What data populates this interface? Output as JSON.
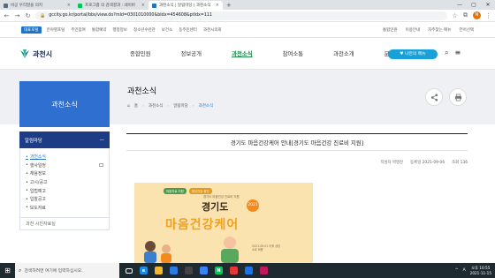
{
  "browser": {
    "tabs": [
      {
        "title": "비공 우리말을 의지",
        "fav": "#5b6b7c",
        "active": false
      },
      {
        "title": "프로그램 의 검색결과 : 네이버",
        "fav": "#03c75a",
        "active": false
      },
      {
        "title": "과천소식 | 알림마당 | 과천소식",
        "fav": "#1e73c7",
        "active": true
      }
    ],
    "new_tab": "+",
    "url": "gccity.go.kr/portal/bbs/view.do?mId=0301010000&bIdx=454608&ptIdx=111",
    "profile_initial": "N",
    "window_controls": [
      "—",
      "▢",
      "✕"
    ]
  },
  "util_bar": {
    "first": "대표포털",
    "links": [
      "분야별포털",
      "주민참여",
      "통합예약",
      "행정정보",
      "청소년수련관",
      "보건소",
      "동주민센터",
      "과천시의회"
    ],
    "right": [
      "통합민원",
      "이용안내",
      "자주찾는 메뉴",
      "언어선택"
    ]
  },
  "nav": {
    "logo": "과천시",
    "menu": [
      "종합민원",
      "정보공개",
      "과천소식",
      "참여소통",
      "과천소개",
      "분야별"
    ],
    "active_index": 2,
    "my_menu_button": "♥ 나만의 메뉴"
  },
  "hero": {
    "side_title": "과천소식",
    "page_heading": "과천소식",
    "breadcrumb": [
      "홈",
      "과천소식",
      "알림마당",
      "과천소식"
    ]
  },
  "sidebar": {
    "section": "알림마당",
    "items": [
      "과천소식",
      "행사일정",
      "채용정보",
      "고시/공고",
      "입법예고",
      "입찰공고",
      "보도자료"
    ],
    "active_index": 0,
    "external_index": 1,
    "next_section": "과천 시진자료실"
  },
  "post": {
    "title": "경기도 마음건강케어 안내[경기도 마음건강 진료비 지원]",
    "meta": [
      "작성자 박명진",
      "등록일 2021-09-06",
      "조회 136"
    ]
  },
  "poster": {
    "pills": [
      "마음치료 지원",
      "정신건강 증진"
    ],
    "sub": "경기도 마음건강 진료비 지원",
    "line1": "경기도",
    "badge": "2021",
    "line2": "마음건강케어",
    "sign": "2021.09.01 이후 상담 소요 비용"
  },
  "taskbar": {
    "search_placeholder": "검색하려면 여기에 입력하십시오.",
    "apps": [
      {
        "label": "",
        "color": "transparent"
      },
      {
        "label": "e",
        "color": "#1e88e5"
      },
      {
        "label": "",
        "color": "#f2b82f"
      },
      {
        "label": "",
        "color": "#2c7be5"
      },
      {
        "label": "",
        "color": "#444"
      },
      {
        "label": "",
        "color": "#3b82f6"
      },
      {
        "label": "N",
        "color": "#03c75a"
      },
      {
        "label": "",
        "color": "#e53935"
      },
      {
        "label": "",
        "color": "#1a73e8"
      },
      {
        "label": "",
        "color": "#c2185b"
      }
    ],
    "tray": [
      "A",
      "^"
    ],
    "time_line1": "오후 10:55",
    "time_line2": "2021-11-15"
  }
}
